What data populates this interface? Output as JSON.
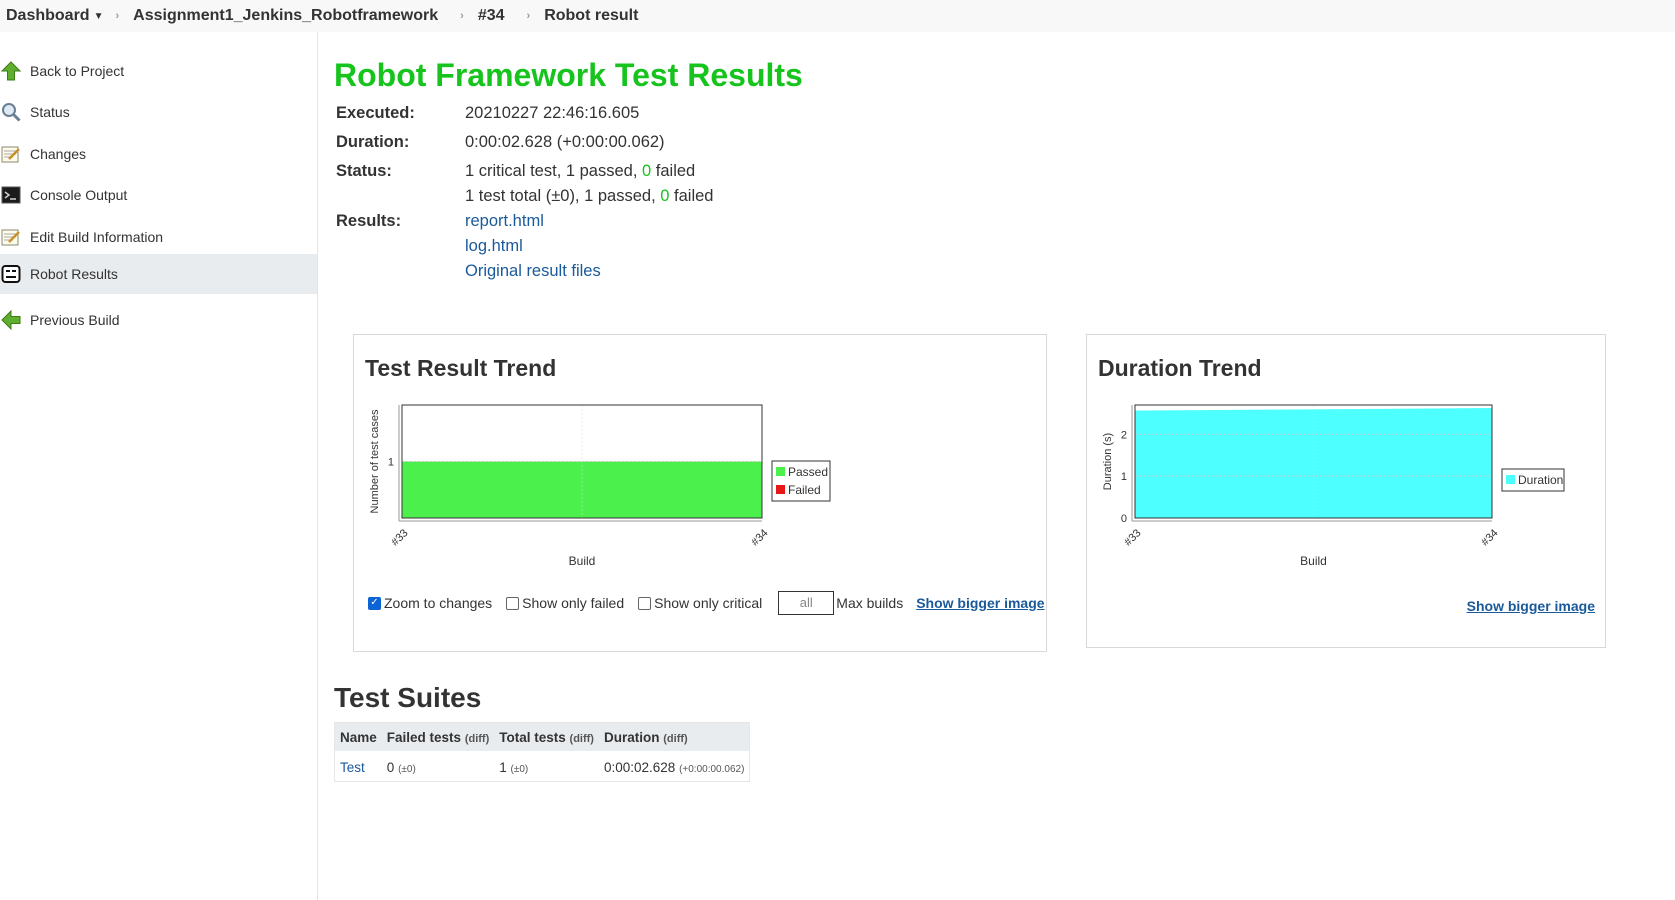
{
  "breadcrumb": {
    "items": [
      {
        "label": "Dashboard"
      },
      {
        "label": "Assignment1_Jenkins_Robotframework"
      },
      {
        "label": "#34"
      },
      {
        "label": "Robot result"
      }
    ]
  },
  "sidebar": {
    "items": [
      {
        "label": "Back to Project",
        "icon": "up-arrow-icon"
      },
      {
        "label": "Status",
        "icon": "magnifier-icon"
      },
      {
        "label": "Changes",
        "icon": "notepad-icon"
      },
      {
        "label": "Console Output",
        "icon": "terminal-icon"
      },
      {
        "label": "Edit Build Information",
        "icon": "notepad-icon"
      },
      {
        "label": "Robot Results",
        "icon": "robot-icon"
      },
      {
        "label": "Previous Build",
        "icon": "left-arrow-icon"
      }
    ],
    "active_index": 5
  },
  "main": {
    "title": "Robot Framework Test Results",
    "executed_label": "Executed:",
    "executed_value": "20210227 22:46:16.605",
    "duration_label": "Duration:",
    "duration_value": "0:00:02.628 (+0:00:00.062)",
    "status_label": "Status:",
    "status_line1_pre": "1 critical test, 1 passed, ",
    "status_line1_failed": "0",
    "status_line1_post": " failed",
    "status_line2_pre": "1 test total (±0), 1 passed, ",
    "status_line2_failed": "0",
    "status_line2_post": " failed",
    "results_label": "Results:",
    "links": [
      "report.html",
      "log.html",
      "Original result files"
    ]
  },
  "trend": {
    "title": "Test Result Trend",
    "controls": {
      "zoom_label": "Zoom to changes",
      "zoom_checked": true,
      "only_failed_label": "Show only failed",
      "only_failed_checked": false,
      "only_critical_label": "Show only critical",
      "only_critical_checked": false,
      "max_builds_value": "all",
      "max_builds_label": "Max builds",
      "bigger_label": "Show bigger image"
    }
  },
  "duration": {
    "title": "Duration Trend",
    "bigger_label": "Show bigger image"
  },
  "colors": {
    "passed": "#4cf04c",
    "failed": "#e81818",
    "duration": "#4dffff",
    "title_green": "#17c41d",
    "link": "#1a5a9b"
  },
  "chart_data": [
    {
      "type": "area",
      "ylabel": "Number of test cases",
      "xlabel": "Build",
      "x": [
        "#33",
        "#34"
      ],
      "yticks": [
        1
      ],
      "ylim": [
        0,
        2
      ],
      "series": [
        {
          "name": "Passed",
          "values": [
            1,
            1
          ],
          "color": "#4cf04c"
        },
        {
          "name": "Failed",
          "values": [
            0,
            0
          ],
          "color": "#e81818"
        }
      ],
      "legend": "right",
      "grid": true
    },
    {
      "type": "area",
      "ylabel": "Duration (s)",
      "xlabel": "Build",
      "x": [
        "#33",
        "#34"
      ],
      "yticks": [
        0,
        1,
        2
      ],
      "ylim": [
        0,
        2.7
      ],
      "series": [
        {
          "name": "Duration",
          "values": [
            2.566,
            2.628
          ],
          "color": "#4dffff"
        }
      ],
      "legend": "right",
      "grid": true
    }
  ],
  "suites": {
    "title": "Test Suites",
    "headers": [
      {
        "label": "Name",
        "diff": ""
      },
      {
        "label": "Failed tests",
        "diff": "(diff)"
      },
      {
        "label": "Total tests",
        "diff": "(diff)"
      },
      {
        "label": "Duration",
        "diff": "(diff)"
      }
    ],
    "rows": [
      {
        "name": "Test",
        "failed": "0",
        "failed_diff": "(±0)",
        "total": "1",
        "total_diff": "(±0)",
        "duration": "0:00:02.628",
        "duration_diff": "(+0:00:00.062)"
      }
    ]
  }
}
